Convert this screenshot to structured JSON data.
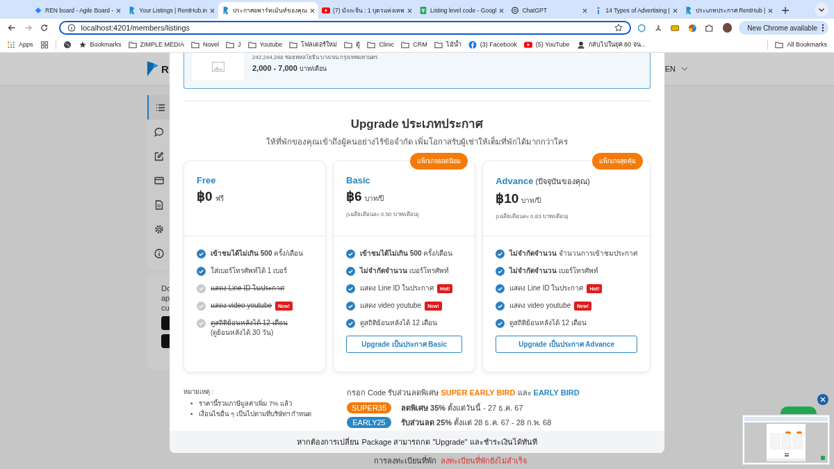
{
  "browser": {
    "tabs": [
      {
        "title": "REN board - Agile Board -",
        "selected": false
      },
      {
        "title": "Your Listings | RentHub.in",
        "selected": false
      },
      {
        "title": "ประกาศอพาร์ทเม้นท์ของคุณ",
        "selected": true
      },
      {
        "title": "(7) มังงะจีน : 1 บุตรแห่งเทพ",
        "selected": false
      },
      {
        "title": "Listing level code - Googl",
        "selected": false
      },
      {
        "title": "ChatGPT",
        "selected": false
      },
      {
        "title": "14 Types of Advertising |",
        "selected": false
      },
      {
        "title": "ประเภทประกาศ RentHub |",
        "selected": false
      }
    ],
    "address": "localhost:4201/members/listings",
    "update_button": "New Chrome available",
    "bookmarks": [
      {
        "kind": "apps",
        "label": "Apps"
      },
      {
        "kind": "star",
        "label": "Bookmarks"
      },
      {
        "kind": "folder",
        "label": "ZIMPLE MEDIA"
      },
      {
        "kind": "folder",
        "label": "Novel"
      },
      {
        "kind": "folder",
        "label": "J"
      },
      {
        "kind": "folder",
        "label": "Youtube"
      },
      {
        "kind": "folder",
        "label": "โฟลเดอร์ใหม่"
      },
      {
        "kind": "folder",
        "label": "ตู้"
      },
      {
        "kind": "folder",
        "label": "Clinic"
      },
      {
        "kind": "folder",
        "label": "CRM"
      },
      {
        "kind": "folder",
        "label": "ไม้น้ำ"
      },
      {
        "kind": "facebook",
        "label": "(3) Facebook"
      },
      {
        "kind": "youtube",
        "label": "(5) YouTube"
      },
      {
        "kind": "page",
        "label": "กลับไปในยุค 80 จน..."
      }
    ],
    "all_bookmarks": "All Bookmarks"
  },
  "page": {
    "logo_letter": "R",
    "language": "EN",
    "side_texts": [
      "Do",
      "ap",
      "cu"
    ],
    "bottom_label": "การลงทะเบียนที่พัก",
    "bottom_status": "ลงทะเบียนที่พักยังไม่สำเร็จ"
  },
  "modal": {
    "listing": {
      "address": "242,244,248 ซอยพหลโยธิน บางเขน กรุงเทพมหานคร",
      "price": "2,000 - 7,000",
      "price_unit": "บาท/เดือน"
    },
    "title": "Upgrade ประเภทประกาศ",
    "subtitle": "ให้ที่พักของคุณเข้าถึงผู้คนอย่างไร้ข้อจำกัด เพิ่มโอกาสรับผู้เช่าให้เต็มที่พักได้มากกว่าใคร",
    "plans": [
      {
        "name": "Free",
        "price": "฿0",
        "unit": "ฟรี",
        "features": [
          {
            "text": "**เข้าชมได้ไม่เกิน 500** ครั้ง/เดือน",
            "included": true
          },
          {
            "text": "ใส่เบอร์โทรศัพท์ได้ 1 เบอร์",
            "included": true
          },
          {
            "text": "แสดง Line ID ในประกาศ",
            "included": false
          },
          {
            "text": "แสดง video youtube",
            "included": false,
            "badge": "New!"
          },
          {
            "text": "ดูสถิติย้อนหลังได้ 12 เดือน",
            "included": false,
            "detail": "(ดูย้อนหลังได้ 30 วัน)"
          }
        ]
      },
      {
        "name": "Basic",
        "ribbon": "แพ็กเกจยอดนิยม",
        "price": "฿6",
        "unit": "บาท/ปี",
        "average": "(เฉลี่ยเดือนละ 0.50 บาท/เดือน)",
        "button": "Upgrade เป็นประกาศ Basic",
        "features": [
          {
            "text": "**เข้าชมได้ไม่เกิน 500** ครั้ง/เดือน",
            "included": true
          },
          {
            "text": "**ไม่จำกัดจำนวน** เบอร์โทรศัพท์",
            "included": true
          },
          {
            "text": "แสดง Line ID ในประกาศ",
            "included": true,
            "badge": "Hot!"
          },
          {
            "text": "แสดง video youtube",
            "included": true,
            "badge": "New!"
          },
          {
            "text": "ดูสถิติย้อนหลังได้ 12 เดือน",
            "included": true
          }
        ]
      },
      {
        "name": "Advance",
        "note": "(ปัจจุบันของคุณ)",
        "ribbon": "แพ็กเกจสุดคุ้ม",
        "price": "฿10",
        "unit": "บาท/ปี",
        "average": "(เฉลี่ยเดือนละ 0.83 บาท/เดือน)",
        "button": "Upgrade เป็นประกาศ Advance",
        "features": [
          {
            "text": "**ไม่จำกัดจำนวน** จำนวนการเข้าชมประกาศ",
            "included": true
          },
          {
            "text": "**ไม่จำกัดจำนวน** เบอร์โทรศัพท์",
            "included": true
          },
          {
            "text": "แสดง Line ID ในประกาศ",
            "included": true,
            "badge": "Hot!"
          },
          {
            "text": "แสดง video youtube",
            "included": true,
            "badge": "New!"
          },
          {
            "text": "ดูสถิติย้อนหลังได้ 12 เดือน",
            "included": true
          }
        ]
      }
    ],
    "notes_title": "หมายเหตุ :",
    "notes": [
      {
        "bullet": "•",
        "text": "ราคานี้รวมภาษีมูลค่าเพิ่ม 7% แล้ว"
      },
      {
        "bullet": "•",
        "text": "เงื่อนไขอื่น ๆ เป็นไปตามที่บริษัทฯ กำหนด"
      }
    ],
    "promo_intro": "กรอก Code รับส่วนลดพิเศษ",
    "promo_a": "SUPER EARLY BIRD",
    "promo_and": "และ",
    "promo_b": "EARLY BIRD",
    "codes": [
      {
        "code": "SUPER35",
        "color": "#f47b0a",
        "text": "**ลดพิเศษ 35%** ตั้งแต่วันนี้ - 27 ธ.ค. 67"
      },
      {
        "code": "EARLY25",
        "color": "#2a86c5",
        "text": "**รับส่วนลด 25%** ตั้งแต่ 28 ธ.ค. 67 - 28 ก.พ. 68"
      }
    ],
    "footer": "หากต้องการเปลี่ยน Package สามารถกด \"Upgrade\" และชำระเงินได้ทันที"
  }
}
